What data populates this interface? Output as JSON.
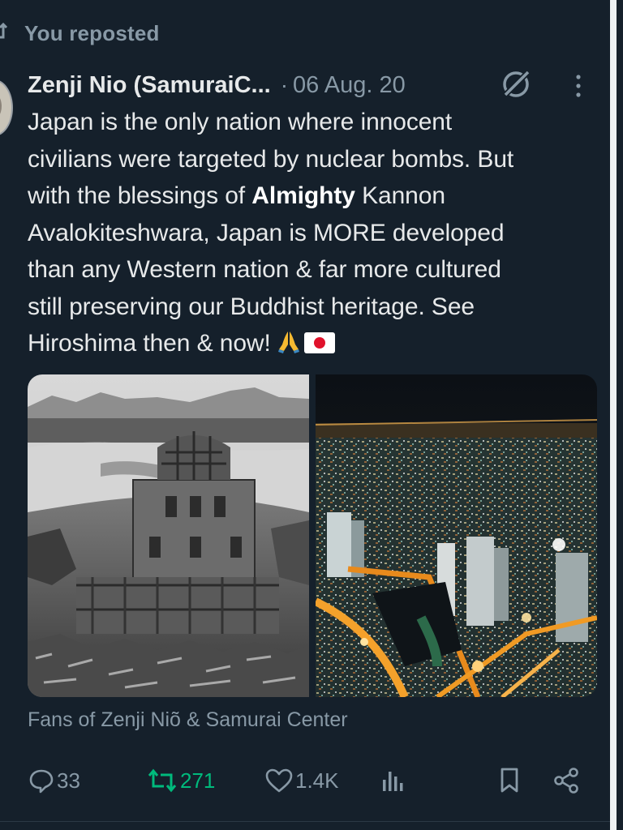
{
  "repost_banner": {
    "text": "You reposted",
    "icon": "repost-icon"
  },
  "post": {
    "author_display": "Zenji Nio (SamuraiC...",
    "separator": "·",
    "date": "06 Aug. 20",
    "text_lines": [
      "Japan is the only nation where innocent",
      "civilians were targeted by nuclear bombs. But",
      "with the blessings of ",
      "Avalokiteshwara, Japan is MORE developed",
      "than any Western nation & far more cultured",
      "still preserving our Buddhist heritage. See",
      "Hiroshima then & now!"
    ],
    "bold_word": "Almighty",
    "line3_tail": " Kannon",
    "emojis": [
      "folded-hands-emoji",
      "japan-flag-emoji"
    ],
    "media": [
      {
        "name": "hiroshima-then-photo",
        "icon": "black-and-white-ruins-image"
      },
      {
        "name": "hiroshima-now-photo",
        "icon": "night-city-aerial-image"
      }
    ],
    "community": "Fans of Zenji Niõ & Samurai Center"
  },
  "actions": {
    "reply": {
      "count": "33",
      "icon": "reply-icon"
    },
    "repost": {
      "count": "271",
      "icon": "repost-icon",
      "color": "#00ba7c"
    },
    "like": {
      "count": "1.4K",
      "icon": "heart-icon"
    },
    "views": {
      "icon": "views-chart-icon"
    },
    "bookmark": {
      "icon": "bookmark-icon"
    },
    "share": {
      "icon": "share-icon"
    }
  },
  "colors": {
    "background": "#15202b",
    "text_primary": "#e7e9ea",
    "text_secondary": "#8899a6",
    "repost_active": "#00ba7c"
  }
}
